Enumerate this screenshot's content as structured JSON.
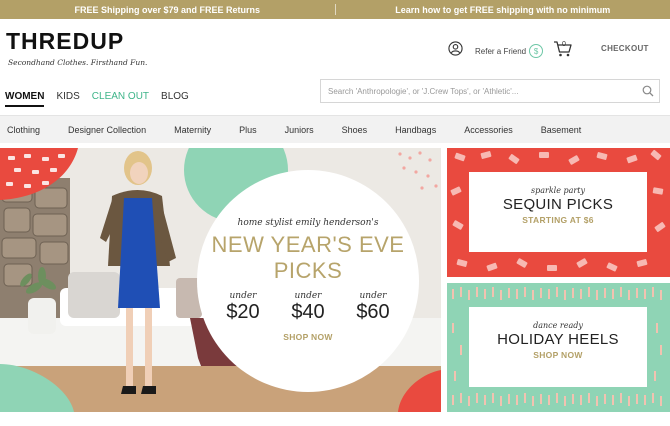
{
  "promo_bar": {
    "left": "FREE Shipping over $79 and FREE Returns",
    "right": "Learn how to get FREE shipping with no minimum"
  },
  "brand": {
    "logo": "THREDUP",
    "tagline": "Secondhand Clothes. Firsthand Fun."
  },
  "header": {
    "refer": "Refer a Friend",
    "refer_badge": "$",
    "cart_count": "0",
    "checkout": "CHECKOUT"
  },
  "main_nav": [
    "WOMEN",
    "KIDS",
    "CLEAN OUT",
    "BLOG"
  ],
  "search": {
    "placeholder": "Search 'Anthropologie', or 'J.Crew Tops', or 'Athletic'..."
  },
  "categories": [
    "Clothing",
    "Designer Collection",
    "Maternity",
    "Plus",
    "Juniors",
    "Shoes",
    "Handbags",
    "Accessories",
    "Basement"
  ],
  "hero": {
    "kicker": "home stylist emily henderson's",
    "title_line1": "NEW YEAR'S EVE",
    "title_line2": "PICKS",
    "prices": [
      {
        "under": "under",
        "amount": "$20"
      },
      {
        "under": "under",
        "amount": "$40"
      },
      {
        "under": "under",
        "amount": "$60"
      }
    ],
    "cta": "SHOP NOW"
  },
  "promo_sequin": {
    "kicker": "sparkle party",
    "title": "SEQUIN PICKS",
    "cta": "STARTING AT $6"
  },
  "promo_heels": {
    "kicker": "dance ready",
    "title": "HOLIDAY HEELS",
    "cta": "SHOP NOW"
  },
  "colors": {
    "gold": "#b3a067",
    "mint": "#8fd4b5",
    "red": "#e94a3f",
    "green_link": "#3eb489"
  }
}
